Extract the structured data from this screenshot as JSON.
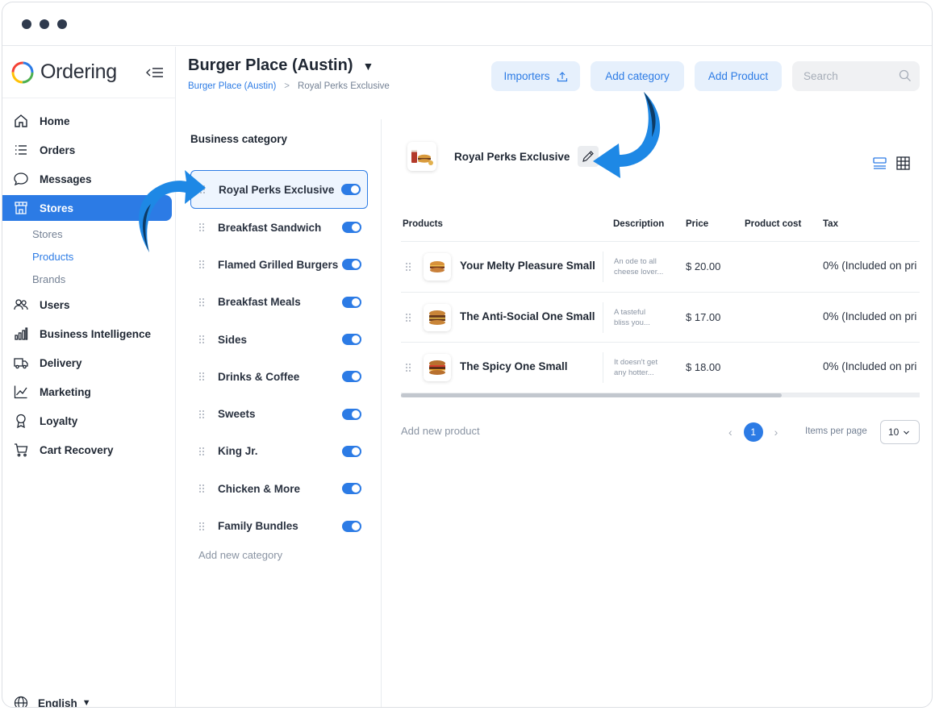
{
  "app": {
    "brand": "Ordering"
  },
  "sidebar": {
    "items": [
      {
        "label": "Home",
        "icon": "home-icon"
      },
      {
        "label": "Orders",
        "icon": "orders-list-icon"
      },
      {
        "label": "Messages",
        "icon": "chat-bubble-icon"
      },
      {
        "label": "Stores",
        "icon": "store-icon",
        "active": true
      }
    ],
    "sub_items": [
      {
        "label": "Stores"
      },
      {
        "label": "Products",
        "active": true
      },
      {
        "label": "Brands"
      }
    ],
    "items_after": [
      {
        "label": "Users",
        "icon": "users-icon"
      },
      {
        "label": "Business Intelligence",
        "icon": "bar-chart-icon"
      },
      {
        "label": "Delivery",
        "icon": "truck-icon"
      },
      {
        "label": "Marketing",
        "icon": "line-chart-icon"
      },
      {
        "label": "Loyalty",
        "icon": "award-icon"
      },
      {
        "label": "Cart Recovery",
        "icon": "cart-icon"
      }
    ],
    "language": "English"
  },
  "header": {
    "store_name": "Burger Place (Austin)",
    "breadcrumb": [
      "Burger Place (Austin)",
      "Royal Perks Exclusive"
    ],
    "importers_label": "Importers",
    "add_category_label": "Add category",
    "add_product_label": "Add Product",
    "search_placeholder": "Search"
  },
  "categories": {
    "heading": "Business category",
    "items": [
      {
        "label": "Royal Perks Exclusive",
        "enabled": true,
        "active": true
      },
      {
        "label": "Breakfast Sandwich",
        "enabled": true
      },
      {
        "label": "Flamed Grilled Burgers",
        "enabled": true
      },
      {
        "label": "Breakfast Meals",
        "enabled": true
      },
      {
        "label": "Sides",
        "enabled": true
      },
      {
        "label": "Drinks & Coffee",
        "enabled": true
      },
      {
        "label": "Sweets",
        "enabled": true
      },
      {
        "label": "King Jr.",
        "enabled": true
      },
      {
        "label": "Chicken & More",
        "enabled": true
      },
      {
        "label": "Family Bundles",
        "enabled": true
      }
    ],
    "add_label": "Add new category"
  },
  "main": {
    "category_title": "Royal Perks Exclusive",
    "columns": [
      "Products",
      "Description",
      "Price",
      "Product cost",
      "Tax"
    ],
    "products": [
      {
        "name": "Your Melty Pleasure Small",
        "description": [
          "An ode to all",
          "cheese lover..."
        ],
        "price": "$ 20.00",
        "cost": "",
        "tax": "0% (Included on pri"
      },
      {
        "name": "The Anti-Social One Small",
        "description": [
          "A tasteful",
          "bliss you..."
        ],
        "price": "$ 17.00",
        "cost": "",
        "tax": "0% (Included on pri"
      },
      {
        "name": "The Spicy One Small",
        "description": [
          "It doesn't get",
          "any hotter..."
        ],
        "price": "$ 18.00",
        "cost": "",
        "tax": "0% (Included on pri"
      }
    ],
    "add_product_label": "Add new product",
    "pagination": {
      "current_page": "1",
      "items_per_page_label": "Items per page",
      "items_per_page": "10"
    }
  },
  "colors": {
    "accent": "#2c7be5",
    "accent_light": "#e6f0fc",
    "annotation_arrow": "#1e88e5"
  }
}
